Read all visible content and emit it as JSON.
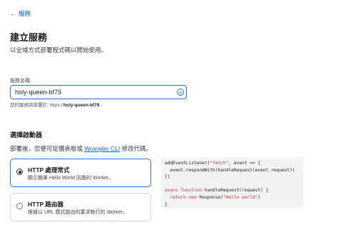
{
  "back": {
    "arrow": "←",
    "label": "服務"
  },
  "page": {
    "title": "建立服務",
    "subtitle": "以全域方式部署程式碼以開始使用。"
  },
  "service_name": {
    "label": "服務名稱",
    "value": "holy-queen-bf79",
    "helper_prefix": "您的服務將部署於: https://",
    "helper_value": "holy-queen-bf79",
    "helper_suffix": "."
  },
  "starter": {
    "title": "選擇啟動器",
    "desc_prefix": "部署後，您便可從儀表板或 ",
    "desc_link": "Wrangler CLI",
    "desc_suffix": " 修改代碼。"
  },
  "options": [
    {
      "title": "HTTP 處理常式",
      "desc": "顯示簡單 Hello World 回應的 Worker。",
      "selected": true
    },
    {
      "title": "HTTP 路由器",
      "desc": "根據以 URL 模式路由的要求執行的 Worker。",
      "selected": false
    }
  ],
  "code": {
    "l1a": "addEventListener(",
    "l1s": "\"fetch\"",
    "l1b": ", event => {",
    "l2": "  event.respondWith(handleRequest(event.request))",
    "l3": "})",
    "l4k": "async function",
    "l4b": " handleRequest(request) {",
    "l5k": "  return new",
    "l5a": " Response(",
    "l5s": "\"Hello world\"",
    "l5b": ")",
    "l6": "}"
  },
  "colors": {
    "accent": "#2f6fdd",
    "link": "#0a63c9",
    "code_string": "#c8303a"
  }
}
